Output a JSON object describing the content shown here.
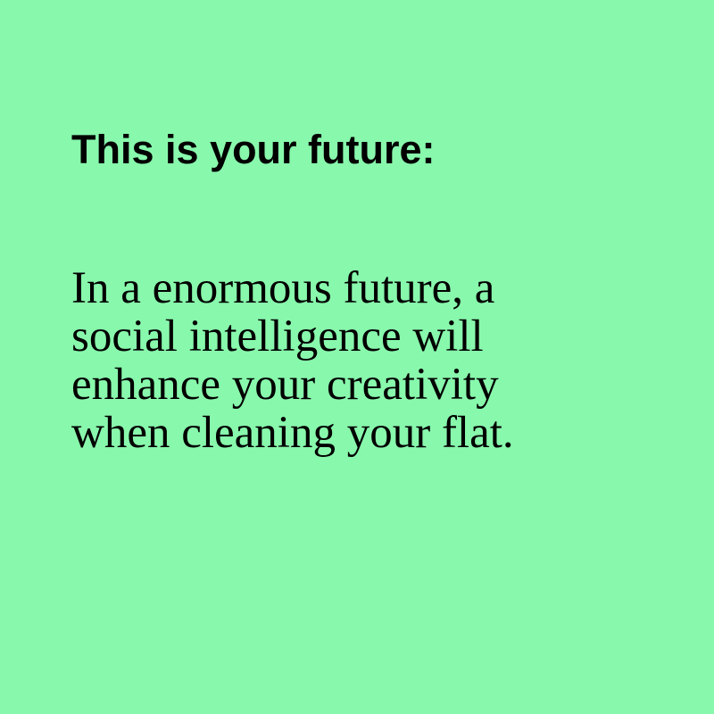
{
  "heading": "This is your future:",
  "body_lines": [
    "In a enormous future, a",
    "social intelligence will",
    "enhance your creativity",
    "when cleaning your flat."
  ],
  "colors": {
    "background": "#88f8ac",
    "text": "#000000"
  }
}
